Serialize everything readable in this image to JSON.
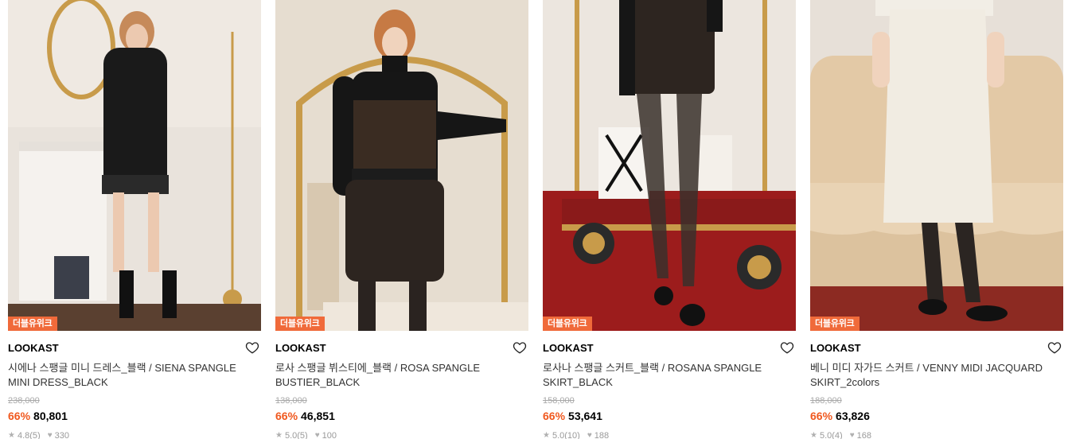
{
  "products": [
    {
      "badge": "더블유위크",
      "brand": "LOOKAST",
      "name": "시에나 스팽글 미니 드레스_블랙 / SIENA SPANGLE MINI DRESS_BLACK",
      "original_price": "238,000",
      "discount": "66%",
      "price": "80,801",
      "rating": "4.8",
      "review_count": "(5)",
      "likes": "330",
      "image_icon": "model-in-black-sequin-mini-dress"
    },
    {
      "badge": "더블유위크",
      "brand": "LOOKAST",
      "name": "로사 스팽글 뷔스티에_블랙 / ROSA SPANGLE BUSTIER_BLACK",
      "original_price": "138,000",
      "discount": "66%",
      "price": "46,851",
      "rating": "5.0",
      "review_count": "(5)",
      "likes": "100",
      "image_icon": "model-in-black-sequin-bustier-set"
    },
    {
      "badge": "더블유위크",
      "brand": "LOOKAST",
      "name": "로사나 스팽글 스커트_블랙 / ROSANA SPANGLE SKIRT_BLACK",
      "original_price": "158,000",
      "discount": "66%",
      "price": "53,641",
      "rating": "5.0",
      "review_count": "(10)",
      "likes": "188",
      "image_icon": "model-in-black-sequin-skirt"
    },
    {
      "badge": "더블유위크",
      "brand": "LOOKAST",
      "name": "베니 미디 자가드 스커트 / VENNY MIDI JACQUARD SKIRT_2colors",
      "original_price": "188,000",
      "discount": "66%",
      "price": "63,826",
      "rating": "5.0",
      "review_count": "(4)",
      "likes": "168",
      "image_icon": "model-in-white-jacquard-midi-skirt"
    }
  ],
  "colors": {
    "badge_bg": "#f06a3a",
    "discount": "#f0581e"
  }
}
